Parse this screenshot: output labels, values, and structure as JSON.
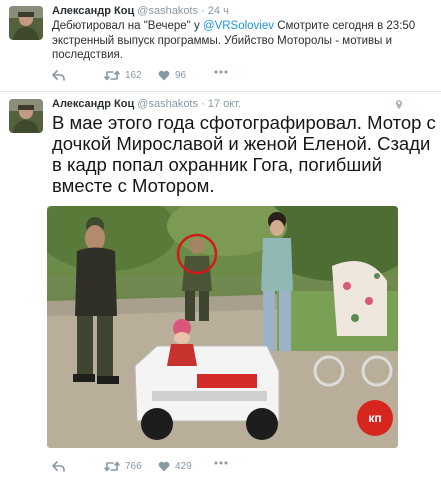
{
  "tweets": [
    {
      "name": "Александр Коц",
      "handle": "@sashakots",
      "time": "· 24 ч",
      "text_before": "Дебютировал на \"Вечере\" у ",
      "mention": "@VRSoloviev",
      "text_after": " Смотрите сегодня в 23:50 экстренный выпуск программы. Убийство Моторолы - мотивы и последствия.",
      "retweets": "162",
      "likes": "96"
    },
    {
      "name": "Александр Коц",
      "handle": "@sashakots",
      "time": "· 17 окт.",
      "text": "В мае этого года сфотографировал. Мотор с дочкой Мирославой и женой Еленой. Сзади в кадр попал охранник Гога, погибший вместе с Мотором.",
      "retweets": "766",
      "likes": "429",
      "photo_watermark": "кп"
    }
  ],
  "icons": {
    "reply": "reply-icon",
    "retweet": "retweet-icon",
    "like": "heart-icon",
    "more": "more-icon",
    "location": "location-pin-icon"
  },
  "colors": {
    "text": "#292f33",
    "muted": "#8899a6",
    "link": "#1b95e0",
    "divider": "#e1e8ed"
  }
}
